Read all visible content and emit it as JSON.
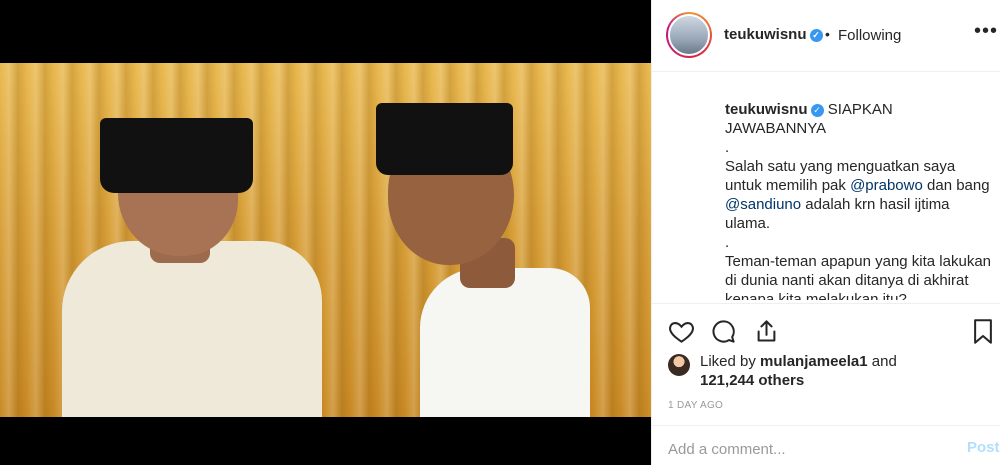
{
  "header": {
    "username": "teukuwisnu",
    "separator": "•",
    "follow_status": "Following",
    "more_label": "•••"
  },
  "caption": {
    "username": "teukuwisnu",
    "line1": "SIAPKAN JAWABANNYA",
    "dot1": ".",
    "para1_a": "Salah satu yang menguatkan saya untuk memilih pak ",
    "mention1": "@prabowo",
    "para1_b": " dan bang ",
    "mention2": "@sandiuno",
    "para1_c": " adalah krn hasil ijtima ulama.",
    "dot2": ".",
    "para2": "Teman-teman apapun yang kita lakukan di dunia nanti akan ditanya di akhirat kenapa kita melakukan itu?"
  },
  "likes": {
    "prefix": "Liked by ",
    "user": "mulanjameela1",
    "middle": " and ",
    "count": "121,244 others"
  },
  "timestamp": "1 DAY AGO",
  "comment": {
    "placeholder": "Add a comment...",
    "post_label": "Post"
  },
  "icons": {
    "like": "heart-icon",
    "comment": "comment-icon",
    "share": "share-icon",
    "save": "bookmark-icon",
    "verified": "verified-badge-icon"
  },
  "colors": {
    "verified": "#3897f0",
    "post_disabled": "#b2dffc",
    "mention": "#003569"
  }
}
